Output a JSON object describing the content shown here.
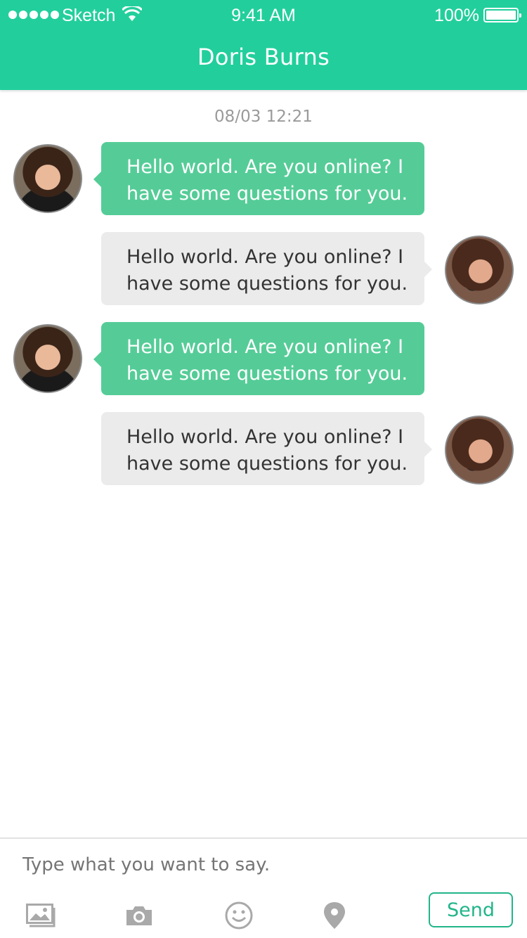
{
  "status_bar": {
    "carrier": "Sketch",
    "time": "9:41 AM",
    "battery": "100%"
  },
  "header": {
    "title": "Doris Burns"
  },
  "conversation": {
    "timestamp": "08/03 12:21",
    "messages": [
      {
        "direction": "incoming",
        "text_line1": "Hello world. Are you online? I",
        "text_line2": "have some questions for you."
      },
      {
        "direction": "outgoing",
        "text_line1": "Hello world. Are you online? I",
        "text_line2": "have some questions for you."
      },
      {
        "direction": "incoming",
        "text_line1": "Hello world. Are you online? I",
        "text_line2": "have some questions for you."
      },
      {
        "direction": "outgoing",
        "text_line1": "Hello world. Are you online? I",
        "text_line2": "have some questions for you."
      }
    ]
  },
  "composer": {
    "placeholder": "Type what you want to say.",
    "send_label": "Send",
    "tools": [
      "image-icon",
      "camera-icon",
      "emoji-icon",
      "location-icon"
    ]
  },
  "colors": {
    "header": "#22cf9c",
    "incoming_bubble": "#55cc97",
    "outgoing_bubble": "#ebebeb",
    "send_accent": "#22b58a"
  }
}
